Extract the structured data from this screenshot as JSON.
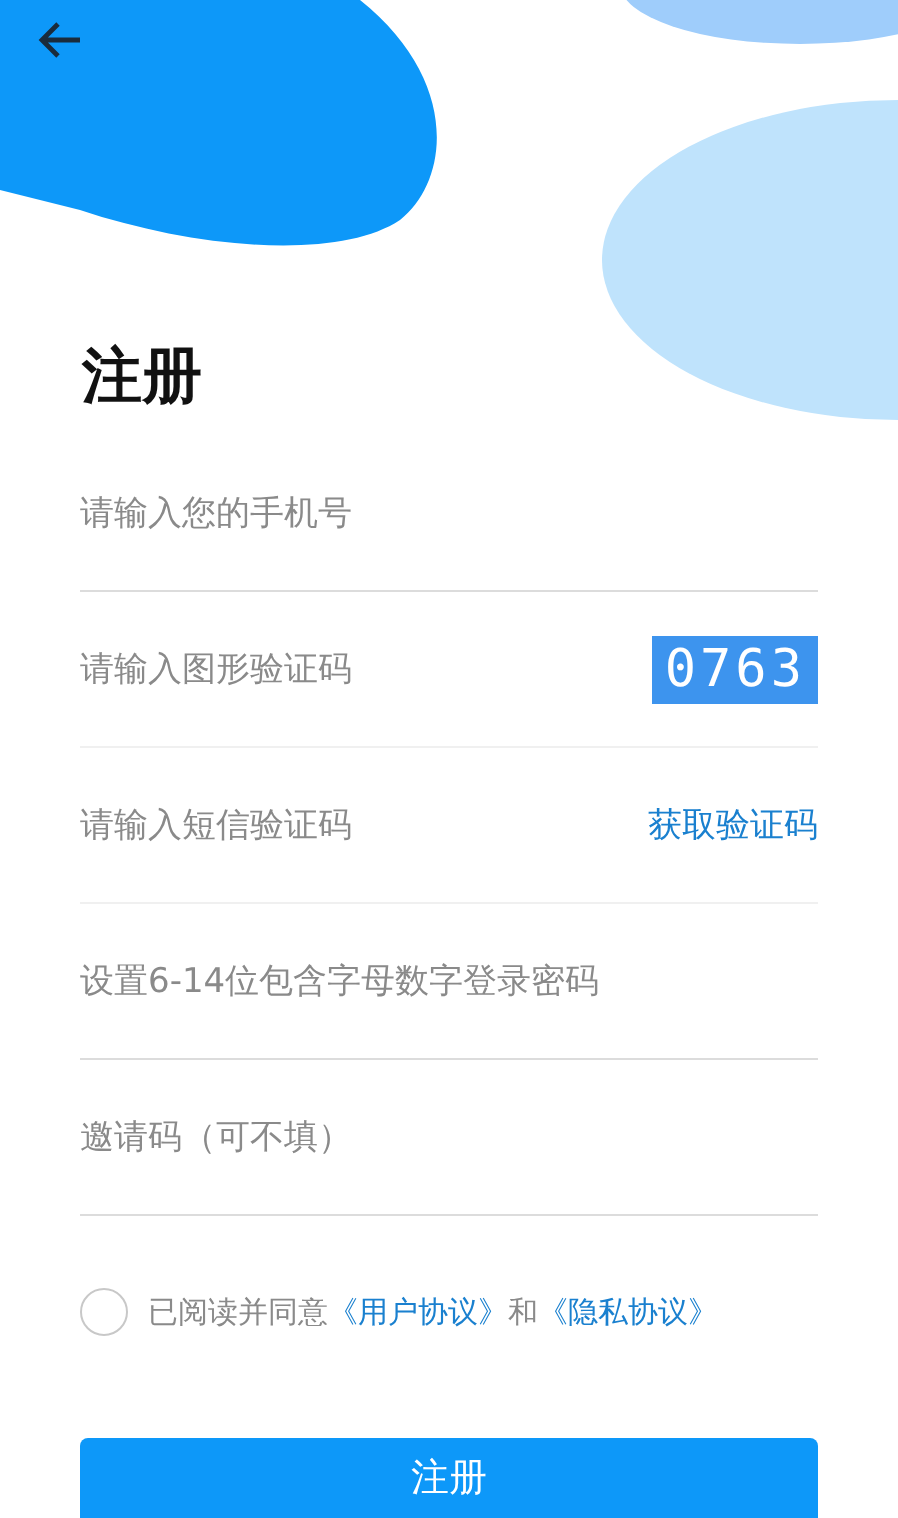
{
  "title": "注册",
  "fields": [
    {
      "kind": "input",
      "placeholder": "请输入您的手机号"
    },
    {
      "kind": "captcha",
      "placeholder": "请输入图形验证码",
      "captcha": "0763"
    },
    {
      "kind": "sms",
      "placeholder": "请输入短信验证码",
      "action": "获取验证码"
    },
    {
      "kind": "input",
      "placeholder": "设置6-14位包含字母数字登录密码"
    },
    {
      "kind": "input",
      "placeholder": "邀请码（可不填）"
    }
  ],
  "agreement": {
    "checked": false,
    "parts": [
      {
        "kind": "text",
        "text": "已阅读并同意"
      },
      {
        "kind": "link",
        "text": "《用户协议》"
      },
      {
        "kind": "text",
        "text": "和"
      },
      {
        "kind": "link",
        "text": "《隐私协议》"
      }
    ]
  },
  "submit": "注册"
}
